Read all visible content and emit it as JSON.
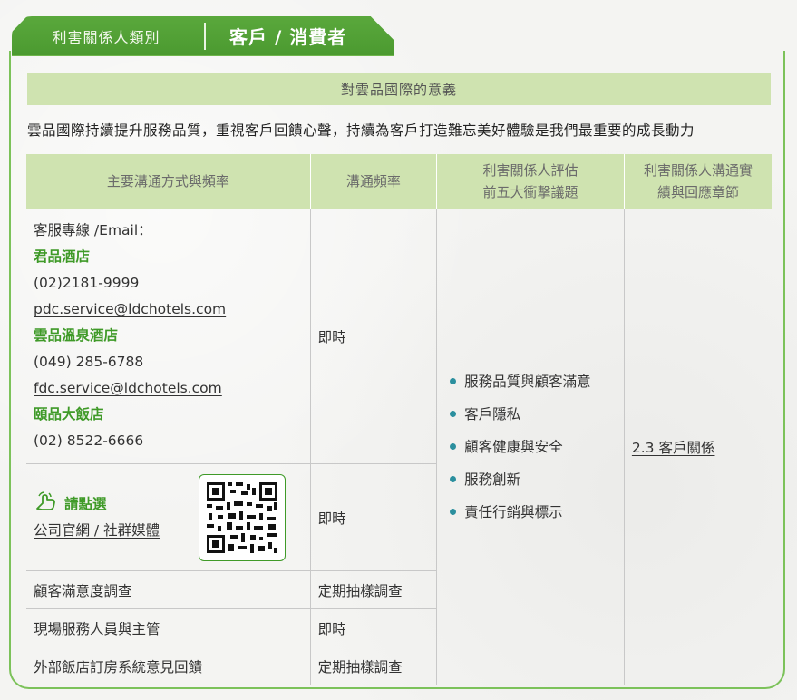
{
  "tab": {
    "category_label": "利害關係人類別",
    "category_value": "客戶 / 消費者"
  },
  "significance": {
    "title": "對雲品國際的意義",
    "text": "雲品國際持續提升服務品質，重視客戶回饋心聲，持續為客戶打造難忘美好體驗是我們最重要的成長動力"
  },
  "table": {
    "headers": {
      "channel": "主要溝通方式與頻率",
      "frequency": "溝通頻率",
      "issues_line1": "利害關係人評估",
      "issues_line2": "前五大衝擊議題",
      "chapter_line1": "利害關係人溝通實",
      "chapter_line2": "績與回應章節"
    },
    "contact": {
      "label": "客服專線 /Email：",
      "hotels": [
        {
          "name": "君品酒店",
          "phone": "(02)2181-9999",
          "email": "pdc.service@ldchotels.com"
        },
        {
          "name": "雲品溫泉酒店",
          "phone": "(049) 285-6788",
          "email": "fdc.service@ldchotels.com "
        },
        {
          "name": "頤品大飯店",
          "phone": "(02) 8522-6666"
        }
      ],
      "frequency": "即時"
    },
    "website": {
      "click_label": "請點選",
      "link_text": "公司官網 / 社群媒體",
      "frequency": "即時"
    },
    "rows": [
      {
        "channel": "顧客滿意度調查",
        "frequency": "定期抽樣調查"
      },
      {
        "channel": "現場服務人員與主管",
        "frequency": "即時"
      },
      {
        "channel": "外部飯店訂房系統意見回饋",
        "frequency": "定期抽樣調查"
      }
    ],
    "issues": [
      "服務品質與顧客滿意",
      "客戶隱私",
      "顧客健康與安全",
      "服務創新",
      "責任行銷與標示"
    ],
    "chapter": "2.3 客戶關係"
  },
  "colors": {
    "accent_green": "#4b9a30",
    "header_bg": "#cfe3b0",
    "bullet": "#2b8f9e"
  },
  "icons": [
    "pointer-hand-icon",
    "qr-code"
  ]
}
